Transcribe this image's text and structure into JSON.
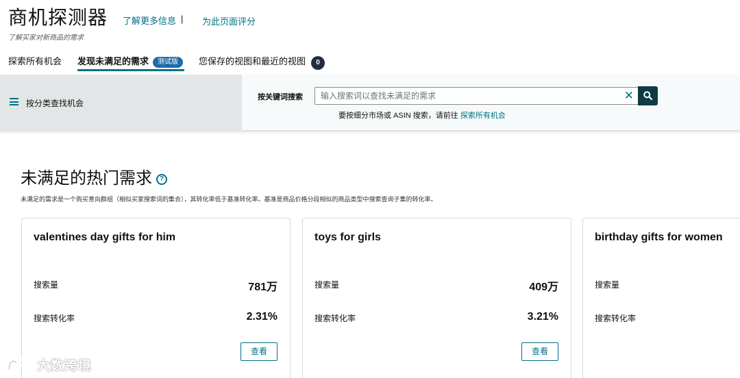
{
  "header": {
    "title": "商机探测器",
    "learn_more": "了解更多信息",
    "separator": "|",
    "rate_page": "为此页面评分",
    "subtitle": "了解买家对新商品的需求"
  },
  "tabs": [
    {
      "label": "探索所有机会"
    },
    {
      "label": "发现未满足的需求",
      "badge": "测试版",
      "active": true
    },
    {
      "label": "您保存的视图和最近的视图",
      "count": "0"
    }
  ],
  "filter": {
    "category_label": "按分类查找机会",
    "keyword_label": "按关键词搜索",
    "search_placeholder": "输入搜索词以查找未满足的需求",
    "hint_text": "要按细分市场或 ASIN 搜索，请前往 ",
    "hint_link": "探索所有机会"
  },
  "section": {
    "title": "未满足的热门需求",
    "description": "未满足的需求是一个购买意向群组（相似买家搜索词的集合），其转化率低于基准转化率。基准是商品价格分段相似的商品类型中搜索查询子集的转化率。"
  },
  "cards": [
    {
      "title": "valentines day gifts for him",
      "volume_label": "搜索量",
      "volume": "781万",
      "conversion_label": "搜索转化率",
      "conversion": "2.31%",
      "button": "查看"
    },
    {
      "title": "toys for girls",
      "volume_label": "搜索量",
      "volume": "409万",
      "conversion_label": "搜索转化率",
      "conversion": "3.21%",
      "button": "查看"
    },
    {
      "title": "birthday gifts for women",
      "volume_label": "搜索量",
      "conversion_label": "搜索转化率"
    }
  ],
  "watermark": {
    "text": "大数跨境"
  },
  "colors": {
    "link": "#007185",
    "badge": "#1f6ba8",
    "search_button": "#0f3b44",
    "panel": "#e3e6e6"
  }
}
